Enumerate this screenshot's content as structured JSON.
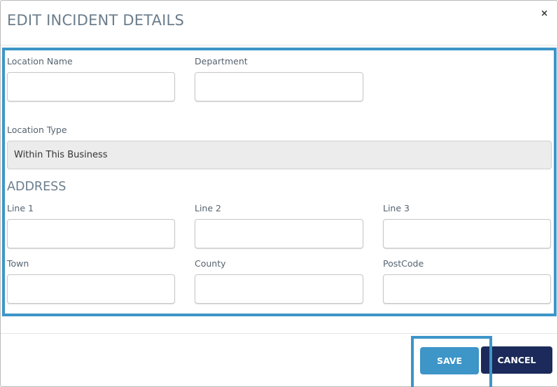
{
  "modal": {
    "title": "EDIT INCIDENT DETAILS",
    "close_glyph": "×"
  },
  "form": {
    "location_name": {
      "label": "Location Name",
      "value": "",
      "placeholder": ""
    },
    "department": {
      "label": "Department",
      "value": "",
      "placeholder": ""
    },
    "location_type": {
      "label": "Location Type",
      "selected": "Within This Business"
    },
    "address": {
      "heading": "ADDRESS",
      "line1": {
        "label": "Line 1",
        "value": "",
        "placeholder": ""
      },
      "line2": {
        "label": "Line 2",
        "value": "",
        "placeholder": ""
      },
      "line3": {
        "label": "Line 3",
        "value": "",
        "placeholder": ""
      },
      "town": {
        "label": "Town",
        "value": "",
        "placeholder": ""
      },
      "county": {
        "label": "County",
        "value": "",
        "placeholder": ""
      },
      "postcode": {
        "label": "PostCode",
        "value": "",
        "placeholder": ""
      }
    }
  },
  "footer": {
    "save_label": "SAVE",
    "cancel_label": "CANCEL"
  },
  "colors": {
    "accent": "#3d95c8",
    "cancel_bg": "#1b2a5a",
    "title_text": "#6b7d8c",
    "select_bg": "#ececec"
  },
  "icons": {
    "close": "close-icon"
  }
}
